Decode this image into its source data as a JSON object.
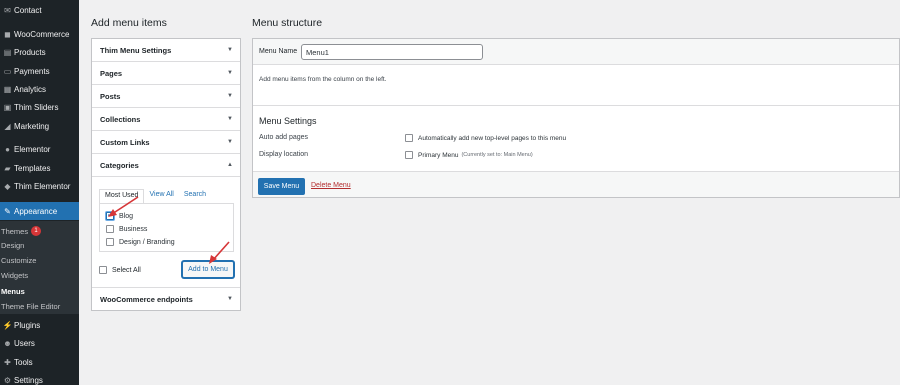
{
  "sidebar": {
    "items": [
      {
        "label": "Contact",
        "icon": "envelope-icon",
        "glyph": "✉"
      },
      {
        "label": "WooCommerce",
        "icon": "woocommerce-icon",
        "glyph": "◼"
      },
      {
        "label": "Products",
        "icon": "box-icon",
        "glyph": "▤"
      },
      {
        "label": "Payments",
        "icon": "card-icon",
        "glyph": "▭"
      },
      {
        "label": "Analytics",
        "icon": "bar-chart-icon",
        "glyph": "▦"
      },
      {
        "label": "Thim Sliders",
        "icon": "slides-icon",
        "glyph": "▣"
      },
      {
        "label": "Marketing",
        "icon": "megaphone-icon",
        "glyph": "◢"
      },
      {
        "label": "Elementor",
        "icon": "elementor-icon",
        "glyph": "●"
      },
      {
        "label": "Templates",
        "icon": "folder-icon",
        "glyph": "▰"
      },
      {
        "label": "Thim Elementor",
        "icon": "settings-icon",
        "glyph": "◆"
      },
      {
        "label": "Appearance",
        "icon": "paintbrush-icon",
        "glyph": "✎"
      },
      {
        "label": "Plugins",
        "icon": "plug-icon",
        "glyph": "⚡"
      },
      {
        "label": "Users",
        "icon": "user-icon",
        "glyph": "☻"
      },
      {
        "label": "Tools",
        "icon": "wrench-icon",
        "glyph": "✚"
      },
      {
        "label": "Settings",
        "icon": "gear-icon",
        "glyph": "⚙"
      }
    ],
    "submenu": [
      {
        "label": "Themes",
        "badge": "1"
      },
      {
        "label": "Design"
      },
      {
        "label": "Customize"
      },
      {
        "label": "Widgets"
      },
      {
        "label": "Menus"
      },
      {
        "label": "Theme File Editor"
      }
    ]
  },
  "left": {
    "heading": "Add menu items",
    "sections": [
      "Thim Menu Settings",
      "Pages",
      "Posts",
      "Collections",
      "Custom Links",
      "Categories"
    ],
    "footer_section": "WooCommerce endpoints",
    "tabs": [
      "Most Used",
      "View All",
      "Search"
    ],
    "categories": [
      {
        "label": "Blog",
        "checked": true
      },
      {
        "label": "Business",
        "checked": false
      },
      {
        "label": "Design / Branding",
        "checked": false
      }
    ],
    "select_all": "Select All",
    "add_button": "Add to Menu"
  },
  "right": {
    "heading": "Menu structure",
    "menu_name_label": "Menu Name",
    "menu_name_value": "Menu1",
    "hint": "Add menu items from the column on the left.",
    "settings_title": "Menu Settings",
    "auto_add_label": "Auto add pages",
    "auto_add_option": "Automatically add new top-level pages to this menu",
    "display_location_label": "Display location",
    "primary_menu_option": "Primary Menu",
    "primary_menu_note": "(Currently set to: Main Menu)",
    "save_button": "Save Menu",
    "delete_link": "Delete Menu"
  },
  "colors": {
    "sidebar_bg": "#1d2327",
    "accent": "#2271b1",
    "delete": "#b32d2e",
    "annotation_arrow": "#d63638"
  }
}
